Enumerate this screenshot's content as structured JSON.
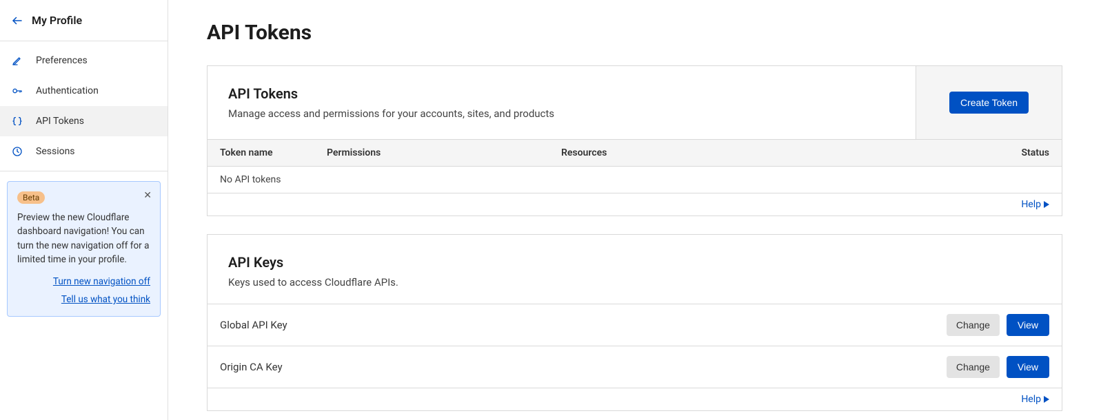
{
  "sidebar": {
    "title": "My Profile",
    "items": [
      {
        "label": "Preferences"
      },
      {
        "label": "Authentication"
      },
      {
        "label": "API Tokens"
      },
      {
        "label": "Sessions"
      }
    ]
  },
  "notice": {
    "badge": "Beta",
    "text": "Preview the new Cloudflare dashboard navigation! You can turn the new navigation off for a limited time in your profile.",
    "link1": "Turn new navigation off",
    "link2": "Tell us what you think"
  },
  "page": {
    "title": "API Tokens"
  },
  "tokens": {
    "title": "API Tokens",
    "desc": "Manage access and permissions for your accounts, sites, and products",
    "create_label": "Create Token",
    "columns": {
      "name": "Token name",
      "permissions": "Permissions",
      "resources": "Resources",
      "status": "Status"
    },
    "empty": "No API tokens",
    "help_label": "Help"
  },
  "keys": {
    "title": "API Keys",
    "desc": "Keys used to access Cloudflare APIs.",
    "rows": [
      {
        "name": "Global API Key",
        "change": "Change",
        "view": "View"
      },
      {
        "name": "Origin CA Key",
        "change": "Change",
        "view": "View"
      }
    ],
    "help_label": "Help"
  }
}
